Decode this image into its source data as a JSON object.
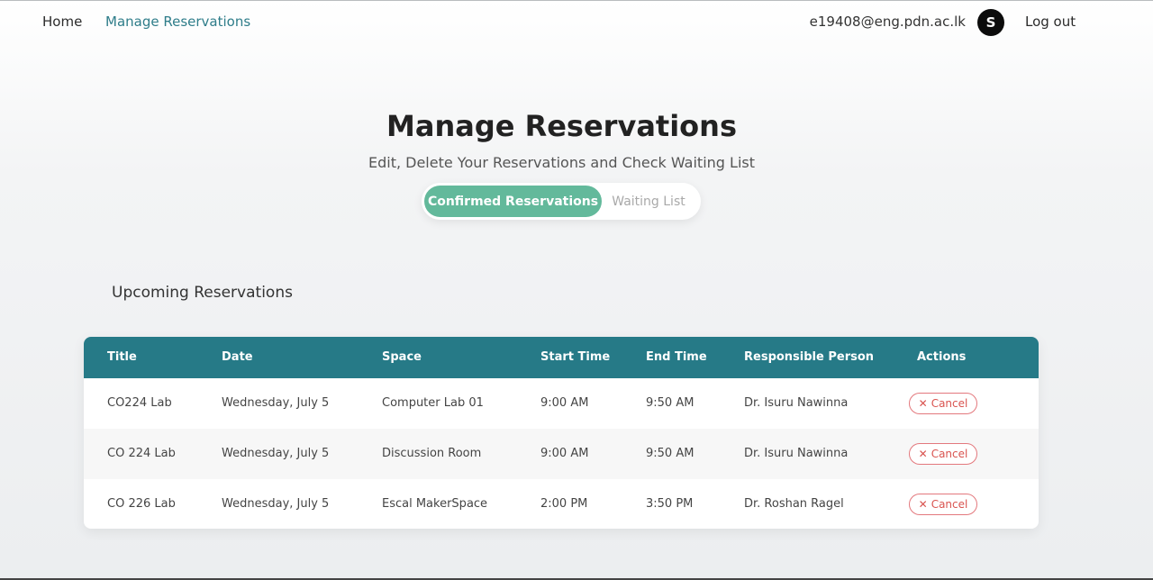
{
  "nav": {
    "home": "Home",
    "manage": "Manage Reservations",
    "email": "e19408@eng.pdn.ac.lk",
    "avatar_initial": "S",
    "logout": "Log out"
  },
  "header": {
    "title": "Manage Reservations",
    "subtitle": "Edit, Delete Your Reservations and Check Waiting List"
  },
  "toggle": {
    "active": "Confirmed Reservations",
    "inactive": "Waiting List"
  },
  "section": {
    "title": "Upcoming Reservations"
  },
  "table": {
    "columns": [
      "Title",
      "Date",
      "Space",
      "Start Time",
      "End Time",
      "Responsible Person",
      "Actions"
    ],
    "rows": [
      {
        "title": "CO224 Lab",
        "date": "Wednesday, July 5",
        "space": "Computer Lab 01",
        "start": "9:00 AM",
        "end": "9:50 AM",
        "person": "Dr. Isuru Nawinna",
        "action": "Cancel"
      },
      {
        "title": "CO 224 Lab",
        "date": "Wednesday, July 5",
        "space": "Discussion Room",
        "start": "9:00 AM",
        "end": "9:50 AM",
        "person": "Dr. Isuru Nawinna",
        "action": "Cancel"
      },
      {
        "title": "CO 226 Lab",
        "date": "Wednesday, July 5",
        "space": "Escal MakerSpace",
        "start": "2:00 PM",
        "end": "3:50 PM",
        "person": "Dr. Roshan Ragel",
        "action": "Cancel"
      }
    ]
  },
  "colors": {
    "accent": "#2f7d8a",
    "table_header": "#267a87",
    "toggle_active": "#63b99b",
    "cancel": "#d9534f"
  }
}
